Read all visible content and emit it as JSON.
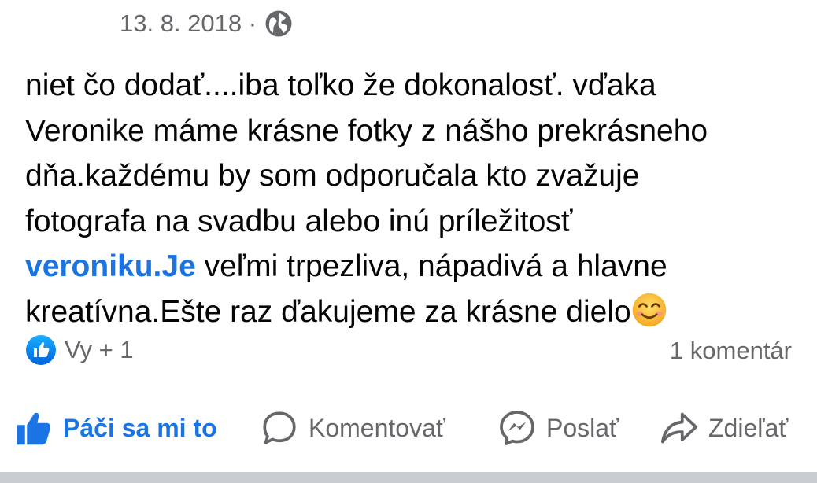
{
  "post": {
    "date": "13. 8. 2018 ·",
    "privacy_icon": "globe-icon",
    "text_lines": [
      "niet čo dodať....iba toľko že dokonalosť. vďaka",
      "Veronike máme krásne fotky z nášho prekrásneho",
      "dňa.každému by som odporučala kto zvažuje",
      "fotografa na svadbu alebo inú príležitosť"
    ],
    "mention": "veroniku.Je",
    "line5_rest": " veľmi trpezliva, nápadivá a hlavne",
    "line6": "kreatívna.Ešte raz ďakujeme za krásne dielo",
    "emoji": "smiling-face-icon"
  },
  "reactions": {
    "summary": "Vy + 1",
    "comments": "1 komentár"
  },
  "actions": {
    "like": "Páči sa mi to",
    "comment": "Komentovať",
    "send": "Poslať",
    "share": "Zdieľať"
  },
  "colors": {
    "accent": "#1b74e4",
    "text": "#050505",
    "muted": "#65676b"
  }
}
